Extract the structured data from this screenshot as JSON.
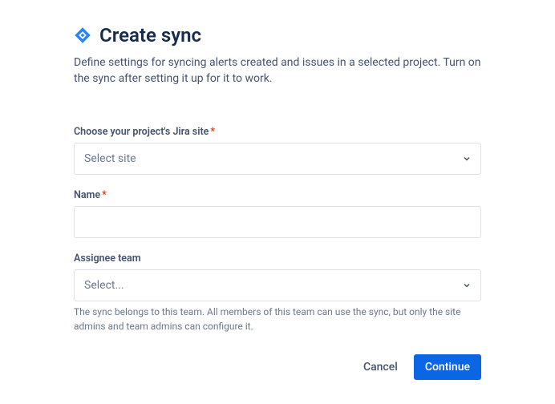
{
  "header": {
    "title": "Create sync"
  },
  "description": "Define settings for syncing alerts created and issues in a selected project. Turn on the sync after setting it up for it to work.",
  "form": {
    "site": {
      "label": "Choose your project's Jira site",
      "required_mark": "*",
      "placeholder": "Select site"
    },
    "name": {
      "label": "Name",
      "required_mark": "*",
      "value": ""
    },
    "team": {
      "label": "Assignee team",
      "placeholder": "Select...",
      "helper": "The sync belongs to this team. All members of this team can use the sync, but only the site admins and team admins can configure it."
    }
  },
  "footer": {
    "cancel": "Cancel",
    "continue": "Continue"
  }
}
